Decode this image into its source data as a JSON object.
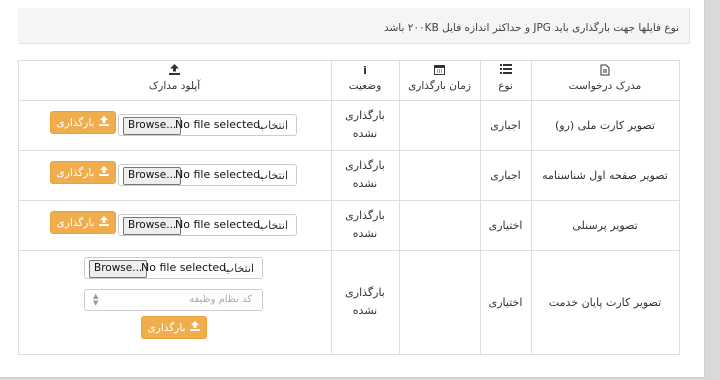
{
  "notice": "نوع فایلها جهت بارگذاری باید JPG و حداکثر اندازه فایل ۲۰۰KB باشد",
  "headers": {
    "document": "مدرک درخواست",
    "type": "نوع",
    "upload_time": "زمان بارگذاری",
    "status": "وضعیت",
    "upload": "آپلود مدارک"
  },
  "icons": {
    "document": "file-icon",
    "type": "list-icon",
    "upload_time": "calendar-icon",
    "status": "info-icon",
    "upload": "upload-icon"
  },
  "rows": [
    {
      "document": "تصویر کارت ملی (رو)",
      "type": "اجباری",
      "upload_time": "",
      "status": "بارگذاری نشده"
    },
    {
      "document": "تصویر صفحه اول شناسنامه",
      "type": "اجباری",
      "upload_time": "",
      "status": "بارگذاری نشده"
    },
    {
      "document": "تصویر پرسنلی",
      "type": "اختیاری",
      "upload_time": "",
      "status": "بارگذاری نشده"
    },
    {
      "document": "تصویر کارت پایان خدمت",
      "type": "اختیاری",
      "upload_time": "",
      "status": "بارگذاری نشده"
    }
  ],
  "file_input": {
    "browse_label": "Browse...",
    "no_file": "No file selected.",
    "select_label": "انتخاب"
  },
  "upload_button_label": "بارگذاری",
  "service_code_placeholder": "کد نظام وظیفه",
  "colors": {
    "accent": "#f0ad4e",
    "border": "#dedede"
  }
}
